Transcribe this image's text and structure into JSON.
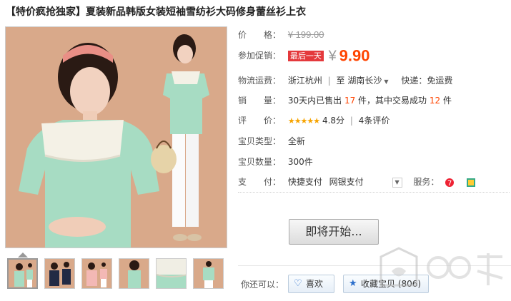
{
  "title": "【特价疯抢独家】夏装新品韩版女装短袖雪纺衫大码修身蕾丝衫上衣",
  "price": {
    "label": "价　　格：",
    "original": "¥ 199.00"
  },
  "promo": {
    "label": "参加促销：",
    "badge": "最后一天",
    "currency": "¥",
    "value": "9.90"
  },
  "shipping": {
    "label": "物流运费：",
    "from": "浙江杭州",
    "sep": "|",
    "to_prefix": "至",
    "to": "湖南长沙",
    "express": "快递：免运费"
  },
  "sales": {
    "label": "销　　量：",
    "text1": "30天内已售出",
    "sold": "17",
    "text2": "件，其中交易成功",
    "success": "12",
    "text3": "件"
  },
  "rating": {
    "label": "评　　价：",
    "stars": "★★★★★",
    "score": "4.8分",
    "sep": "|",
    "reviews": "4条评价"
  },
  "type": {
    "label": "宝贝类型：",
    "value": "全新"
  },
  "quantity": {
    "label": "宝贝数量：",
    "value": "300件"
  },
  "payment": {
    "label": "支　　付：",
    "method1": "快捷支付",
    "method2": "网银支付",
    "service_label": "服务："
  },
  "buy_button": "即将开始...",
  "bottom": {
    "label": "你还可以：",
    "like": "喜欢",
    "favorite": "收藏宝贝 (806)"
  },
  "icons": {
    "heart": "heart-icon",
    "star": "star-icon",
    "dropdown": "chevron-down-icon"
  },
  "colors": {
    "accent": "#ff4400",
    "promo_badge": "#e4393c",
    "stars": "#f7a400",
    "mint": "#a7dcc3",
    "background": "#d9a98a"
  }
}
